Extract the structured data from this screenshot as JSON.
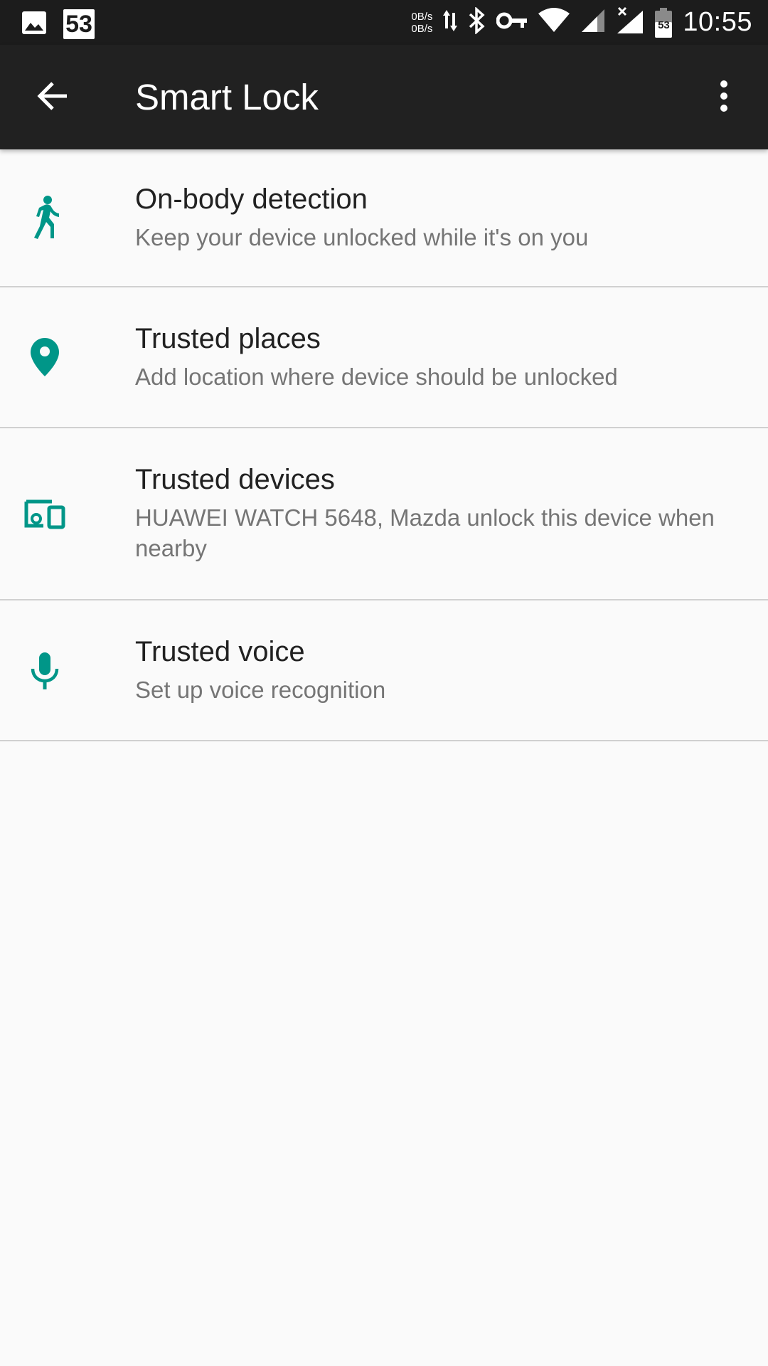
{
  "status_bar": {
    "notification_count": "53",
    "speed_up": "0B/s",
    "speed_down": "0B/s",
    "battery_level": "53",
    "time": "10:55"
  },
  "app_bar": {
    "title": "Smart Lock"
  },
  "items": [
    {
      "title": "On-body detection",
      "summary": "Keep your device unlocked while it's on you",
      "icon": "walking-person-icon"
    },
    {
      "title": "Trusted places",
      "summary": "Add location where device should be unlocked",
      "icon": "location-pin-icon"
    },
    {
      "title": "Trusted devices",
      "summary": "HUAWEI WATCH 5648, Mazda unlock this device when nearby",
      "icon": "devices-icon"
    },
    {
      "title": "Trusted voice",
      "summary": "Set up voice recognition",
      "icon": "microphone-icon"
    }
  ],
  "colors": {
    "accent": "#009688",
    "app_bar": "#212121",
    "status_bar": "#1c1c1c",
    "background": "#fafafa"
  }
}
